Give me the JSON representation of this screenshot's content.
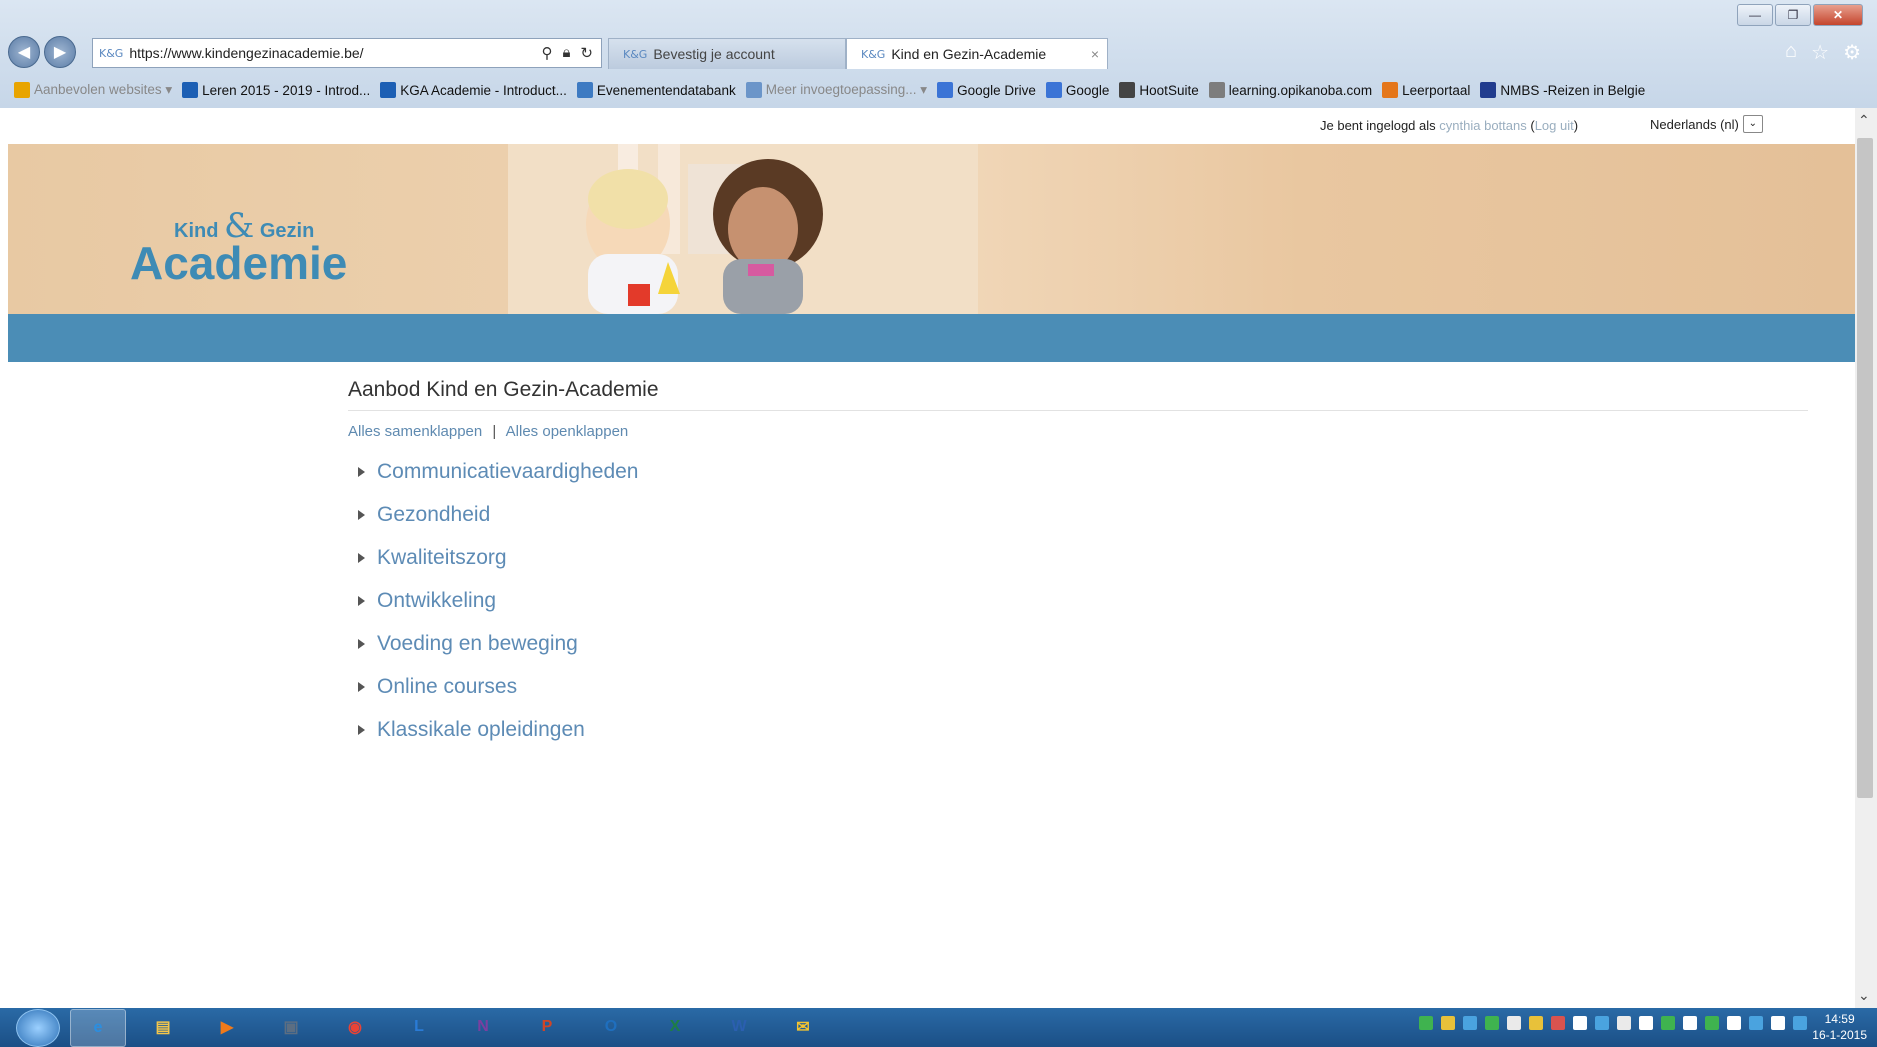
{
  "browser": {
    "address_url": "https://www.kindengezinacademie.be/",
    "tabs": [
      {
        "label": "Bevestig je account",
        "active": false
      },
      {
        "label": "Kind en Gezin-Academie",
        "active": true
      }
    ],
    "tab_close": "×"
  },
  "favorites": [
    {
      "label": "Aanbevolen websites ▾",
      "icon_color": "#e8a400",
      "muted": true
    },
    {
      "label": "Leren 2015 - 2019 - Introd...",
      "icon_color": "#1c5fb4"
    },
    {
      "label": "KGA Academie - Introduct...",
      "icon_color": "#1c5fb4"
    },
    {
      "label": "Evenementendatabank",
      "icon_color": "#3d7ac2"
    },
    {
      "label": "Meer invoegtoepassing... ▾",
      "icon_color": "#6b95c9",
      "muted": true
    },
    {
      "label": "Google Drive",
      "icon_color": "#3b74d6"
    },
    {
      "label": "Google",
      "icon_color": "#3b74d6"
    },
    {
      "label": "HootSuite",
      "icon_color": "#444444"
    },
    {
      "label": "learning.opikanoba.com",
      "icon_color": "#7d7d7d"
    },
    {
      "label": "Leerportaal",
      "icon_color": "#e4761a"
    },
    {
      "label": "NMBS -Reizen in Belgie",
      "icon_color": "#213c8e"
    }
  ],
  "userbar": {
    "prefix": "Je bent ingelogd als",
    "username": "cynthia bottans",
    "logout_open": "(",
    "logout": "Log uit",
    "logout_close": ")",
    "language": "Nederlands (nl)"
  },
  "logo": {
    "small_left": "Kind",
    "amp": "&",
    "small_right": "Gezin",
    "big": "Academie"
  },
  "main": {
    "heading": "Aanbod Kind en Gezin-Academie",
    "collapse_all": "Alles samenklappen",
    "separator": "|",
    "expand_all": "Alles openklappen",
    "categories": [
      "Communicatievaardigheden",
      "Gezondheid",
      "Kwaliteitszorg",
      "Ontwikkeling",
      "Voeding en beweging",
      "Online courses",
      "Klassikale opleidingen"
    ]
  },
  "taskbar": {
    "apps": [
      "windows-explorer",
      "internet-explorer",
      "file-explorer",
      "media-player",
      "app-window",
      "chrome",
      "lync",
      "onenote",
      "powerpoint",
      "outlook",
      "excel",
      "word",
      "messenger"
    ],
    "app_labels": [
      "",
      "e",
      "▤",
      "▶",
      "▣",
      "◉",
      "L",
      "N",
      "P",
      "O",
      "X",
      "W",
      "✉"
    ],
    "clock_time": "14:59",
    "clock_date": "16-1-2015"
  },
  "colors": {
    "link": "#5d8bb5",
    "banner_blue": "#4b8db6",
    "logo_blue": "#3e8bb5"
  }
}
